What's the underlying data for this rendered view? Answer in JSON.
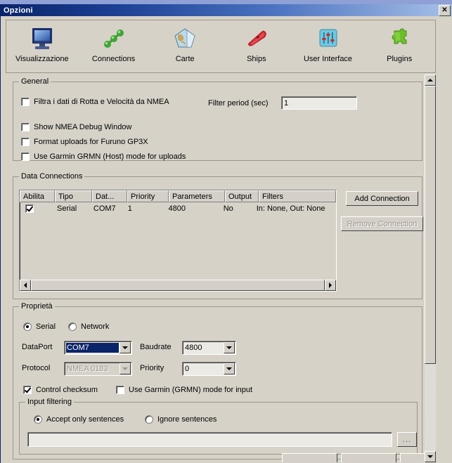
{
  "window": {
    "title": "Opzioni",
    "close_label": "✕"
  },
  "toolbar": {
    "items": [
      {
        "label": "Visualizzazione",
        "icon": "monitor-icon"
      },
      {
        "label": "Connections",
        "icon": "network-nodes-icon"
      },
      {
        "label": "Carte",
        "icon": "map-chart-icon"
      },
      {
        "label": "Ships",
        "icon": "ship-hull-icon"
      },
      {
        "label": "User Interface",
        "icon": "sliders-icon"
      },
      {
        "label": "Plugins",
        "icon": "puzzle-piece-icon"
      }
    ]
  },
  "general": {
    "legend": "General",
    "filter_nmea_label": "Filtra i dati di Rotta e Velocità da NMEA",
    "filter_nmea_checked": false,
    "filter_period_label": "Filter period (sec)",
    "filter_period_value": "1",
    "show_debug_label": "Show NMEA Debug Window",
    "show_debug_checked": false,
    "furuno_label": "Format uploads for Furuno GP3X",
    "furuno_checked": false,
    "garmin_label": "Use Garmin GRMN (Host) mode for uploads",
    "garmin_checked": false
  },
  "data_connections": {
    "legend": "Data Connections",
    "columns": [
      "Abilita",
      "Tipo",
      "Dat...",
      "Priority",
      "Parameters",
      "Output",
      "Filters"
    ],
    "rows": [
      {
        "enabled": true,
        "tipo": "Serial",
        "dat": "COM7",
        "priority": "1",
        "parameters": "4800",
        "output": "No",
        "filters": "In: None, Out: None"
      }
    ],
    "add_button": "Add Connection",
    "remove_button": "Remove Connection",
    "remove_button_disabled": true
  },
  "properties": {
    "legend": "Proprietà",
    "mode_serial": "Serial",
    "mode_network": "Network",
    "mode_selected": "Serial",
    "dataport_label": "DataPort",
    "dataport_value": "COM7",
    "baudrate_label": "Baudrate",
    "baudrate_value": "4800",
    "protocol_label": "Protocol",
    "protocol_value": "NMEA 0183",
    "protocol_disabled": true,
    "priority_label": "Priority",
    "priority_value": "0",
    "control_checksum_label": "Control checksum",
    "control_checksum_checked": true,
    "garmin_input_label": "Use Garmin (GRMN) mode for input",
    "garmin_input_checked": false
  },
  "input_filtering": {
    "legend": "Input filtering",
    "accept_label": "Accept only sentences",
    "ignore_label": "Ignore sentences",
    "selected": "Accept only sentences",
    "sentences_value": "",
    "browse_label": "..."
  },
  "colors": {
    "title_start": "#0a246a",
    "title_end": "#a8c0e8",
    "face": "#d6d2c8",
    "field": "#eceae4",
    "selection": "#0a246a"
  }
}
